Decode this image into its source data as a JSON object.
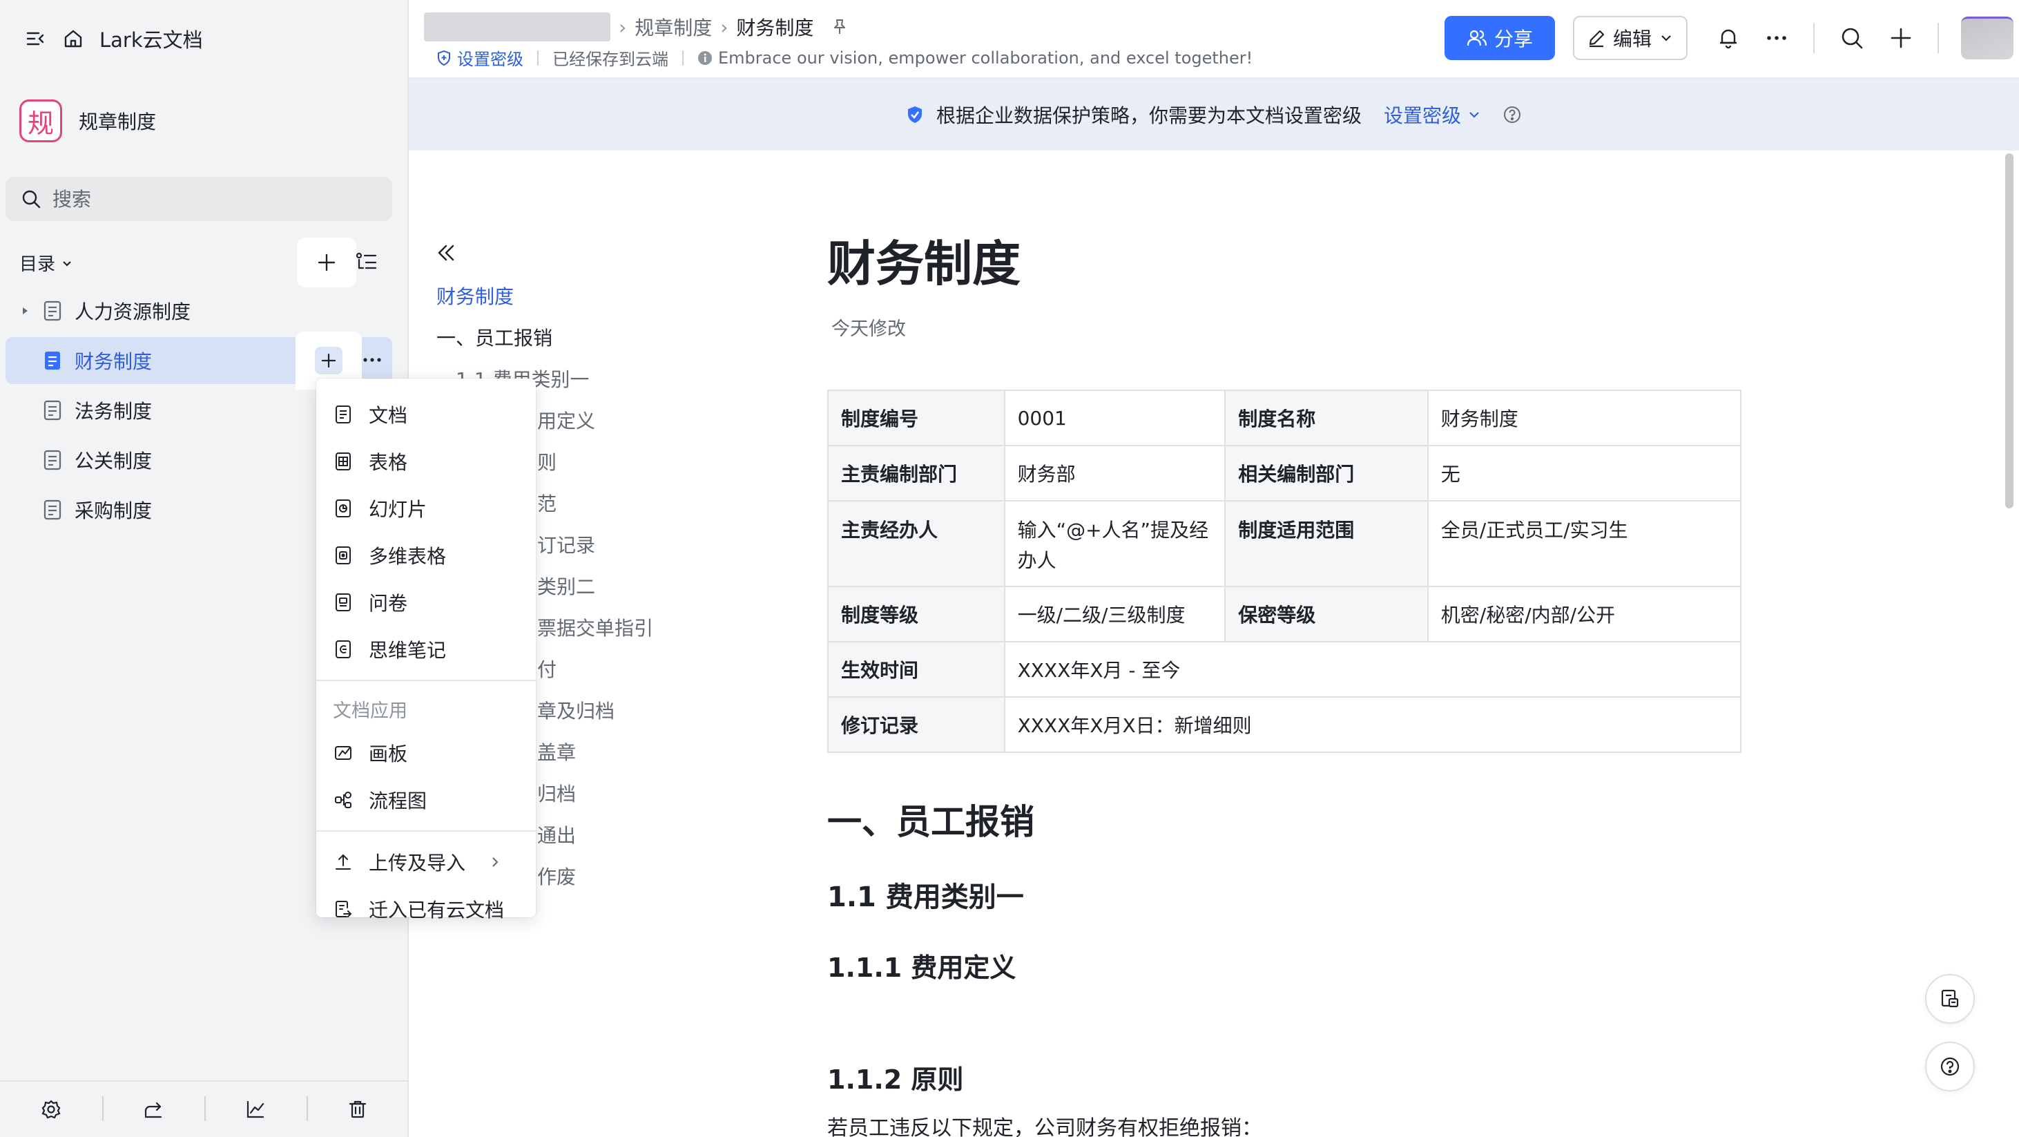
{
  "sidebar": {
    "app_name": "Lark云文档",
    "space_name": "规章制度",
    "space_logo_char": "规",
    "search_placeholder": "搜索",
    "toc_label": "目录",
    "items": [
      {
        "label": "人力资源制度",
        "icon": "doc-icon",
        "has_children": true
      },
      {
        "label": "财务制度",
        "icon": "doc-icon",
        "active": true
      },
      {
        "label": "法务制度",
        "icon": "doc-icon"
      },
      {
        "label": "公关制度",
        "icon": "doc-icon"
      },
      {
        "label": "采购制度",
        "icon": "doc-icon"
      }
    ]
  },
  "dropdown": {
    "items": [
      "文档",
      "表格",
      "幻灯片",
      "多维表格",
      "问卷",
      "思维笔记"
    ],
    "section_title": "文档应用",
    "app_items": [
      "画板",
      "流程图"
    ],
    "upload_label": "上传及导入",
    "migrate_label": "迁入已有云文档"
  },
  "header": {
    "breadcrumb": [
      "规章制度",
      "财务制度"
    ],
    "set_level": "设置密级",
    "saved": "已经保存到云端",
    "slogan": "Embrace our vision, empower collaboration, and excel together!",
    "share_label": "分享",
    "edit_label": "编辑"
  },
  "notice": {
    "text": "根据企业数据保护策略，你需要为本文档设置密级",
    "action": "设置密级"
  },
  "outline": {
    "items": [
      {
        "label": "财务制度",
        "active": true
      },
      {
        "label": "一、员工报销"
      },
      {
        "label": "1.1 费用类别一"
      },
      {
        "label": "用定义"
      },
      {
        "label": "则"
      },
      {
        "label": "范"
      },
      {
        "label": "订记录"
      },
      {
        "label": "类别二"
      },
      {
        "label": "票据交单指引"
      },
      {
        "label": "付"
      },
      {
        "label": "章及归档"
      },
      {
        "label": "盖章"
      },
      {
        "label": "归档"
      },
      {
        "label": "通出"
      },
      {
        "label": "作废"
      }
    ]
  },
  "doc": {
    "title": "财务制度",
    "modified": "今天修改",
    "table": {
      "row1": [
        "制度编号",
        "0001",
        "制度名称",
        "财务制度"
      ],
      "row2": [
        "主责编制部门",
        "财务部",
        "相关编制部门",
        "无"
      ],
      "row3": [
        "主责经办人",
        "输入“@+人名”提及经办人",
        "制度适用范围",
        "全员/正式员工/实习生"
      ],
      "row4": [
        "制度等级",
        "一级/二级/三级制度",
        "保密等级",
        "机密/秘密/内部/公开"
      ],
      "row5": [
        "生效时间",
        "XXXX年X月 - 至今"
      ],
      "row6": [
        "修订记录",
        "XXXX年X月X日：新增细则"
      ]
    },
    "h1": "一、员工报销",
    "h2": "1.1 费用类别一",
    "h3a": "1.1.1 费用定义",
    "h3b": "1.1.2 原则",
    "para": "若员工违反以下规定，公司财务有权拒绝报销："
  },
  "colors": {
    "accent": "#3370ff",
    "active_bg": "#d7e1f6",
    "link": "#2f5fd8"
  }
}
